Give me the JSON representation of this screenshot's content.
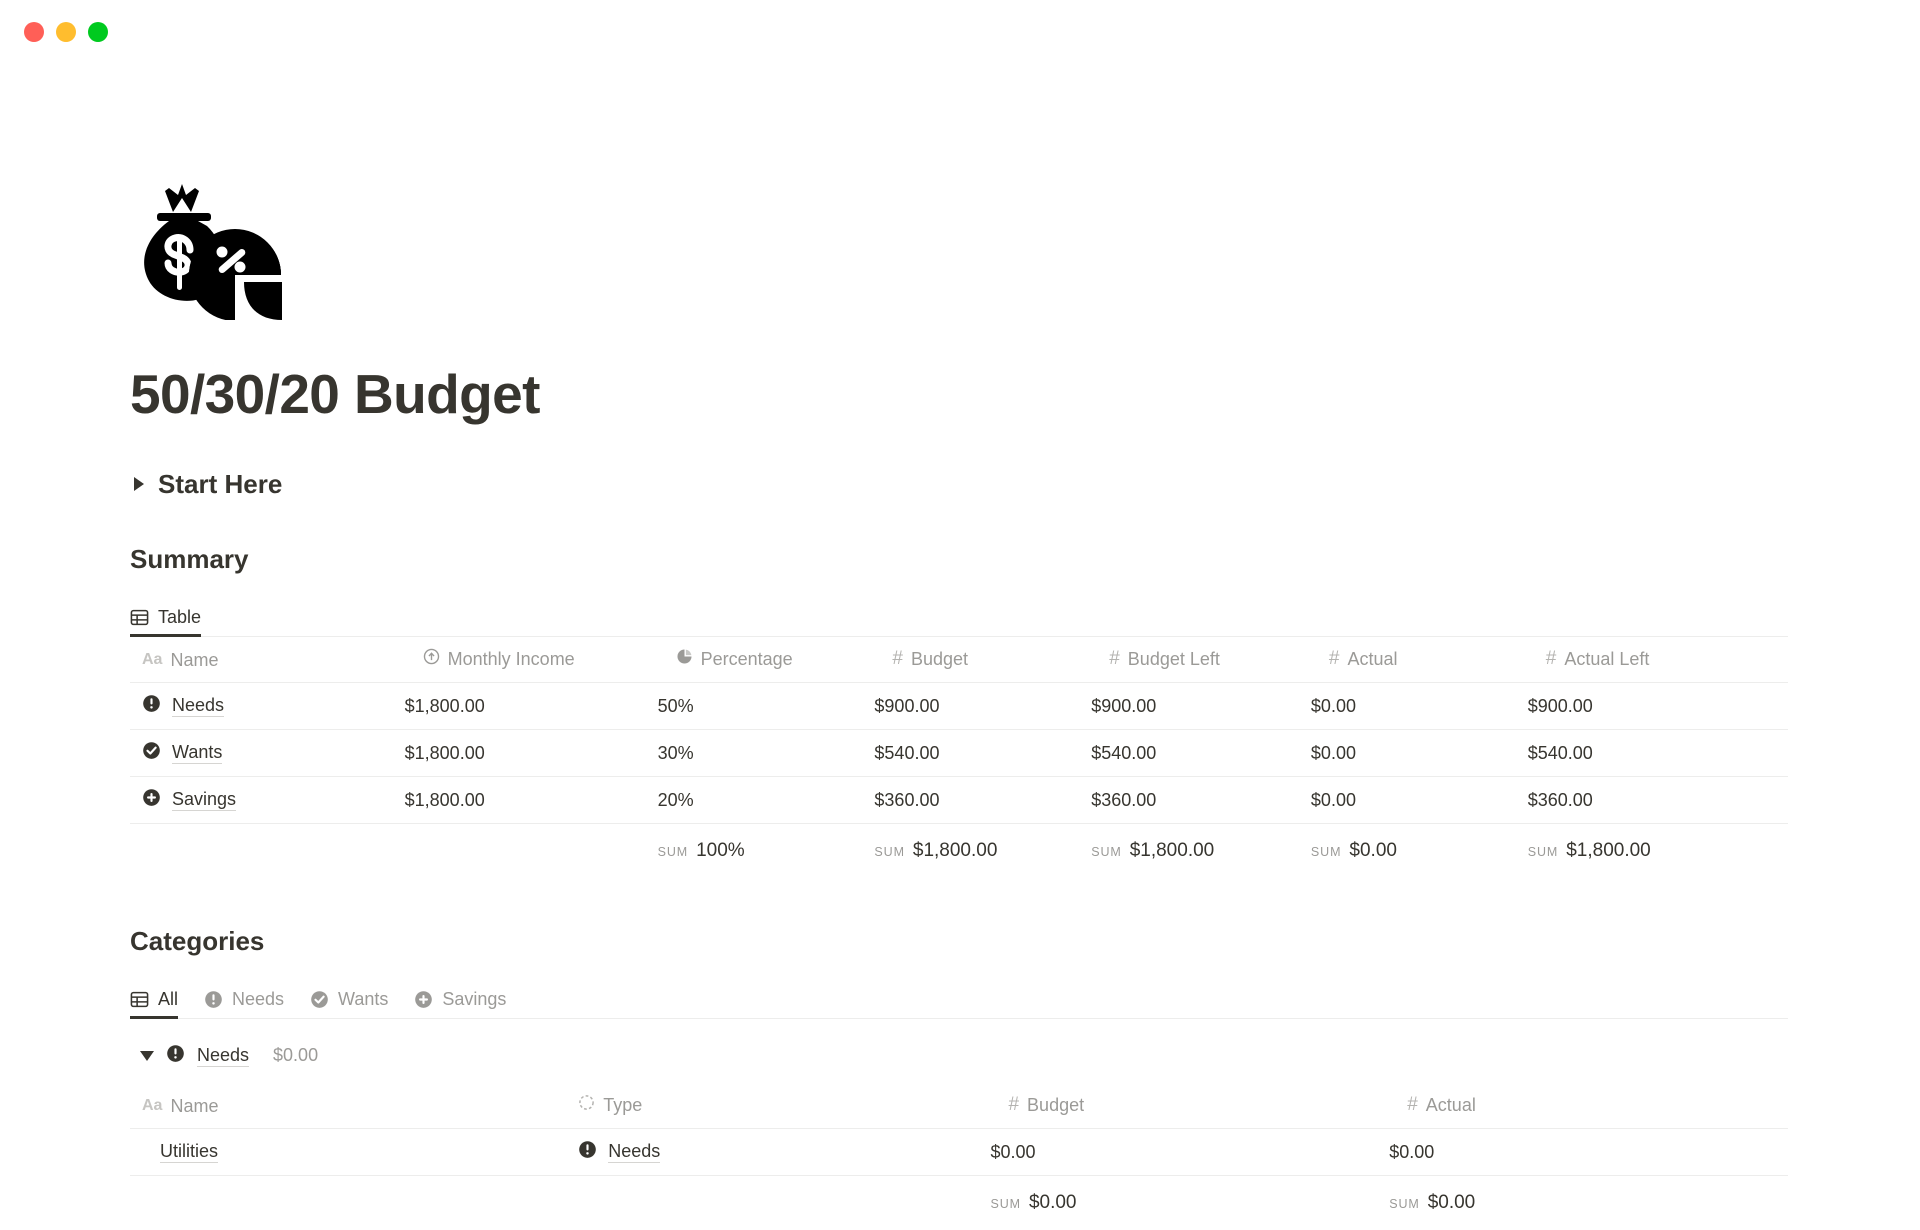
{
  "window": {
    "buttons": [
      {
        "name": "close",
        "color": "#ff5f57"
      },
      {
        "name": "minimize",
        "color": "#ffbd2e"
      },
      {
        "name": "maximize",
        "color": "#00ca1f"
      }
    ]
  },
  "page": {
    "icon": "money-bag-pie-chart-icon",
    "title": "50/30/20 Budget"
  },
  "toggle": {
    "label": "Start Here",
    "expanded": false
  },
  "summary": {
    "heading": "Summary",
    "tabs": [
      {
        "label": "Table",
        "icon": "table-icon",
        "active": true
      }
    ],
    "columns": [
      {
        "label": "Name",
        "icon": "title-icon"
      },
      {
        "label": "Monthly Income",
        "icon": "rollup-icon"
      },
      {
        "label": "Percentage",
        "icon": "formula-pie-icon"
      },
      {
        "label": "Budget",
        "icon": "number-icon"
      },
      {
        "label": "Budget Left",
        "icon": "number-icon"
      },
      {
        "label": "Actual",
        "icon": "number-icon"
      },
      {
        "label": "Actual Left",
        "icon": "number-icon"
      }
    ],
    "rows": [
      {
        "icon": "exclamation-circle-icon",
        "name": "Needs",
        "monthly_income": "$1,800.00",
        "percentage": "50%",
        "budget": "$900.00",
        "budget_left": "$900.00",
        "actual": "$0.00",
        "actual_left": "$900.00"
      },
      {
        "icon": "check-circle-icon",
        "name": "Wants",
        "monthly_income": "$1,800.00",
        "percentage": "30%",
        "budget": "$540.00",
        "budget_left": "$540.00",
        "actual": "$0.00",
        "actual_left": "$540.00"
      },
      {
        "icon": "plus-circle-icon",
        "name": "Savings",
        "monthly_income": "$1,800.00",
        "percentage": "20%",
        "budget": "$360.00",
        "budget_left": "$360.00",
        "actual": "$0.00",
        "actual_left": "$360.00"
      }
    ],
    "footer": {
      "sum_label": "SUM",
      "percentage": "100%",
      "budget": "$1,800.00",
      "budget_left": "$1,800.00",
      "actual": "$0.00",
      "actual_left": "$1,800.00"
    }
  },
  "categories": {
    "heading": "Categories",
    "tabs": [
      {
        "label": "All",
        "icon": "table-icon",
        "active": true
      },
      {
        "label": "Needs",
        "icon": "exclamation-circle-icon",
        "active": false
      },
      {
        "label": "Wants",
        "icon": "check-circle-icon",
        "active": false
      },
      {
        "label": "Savings",
        "icon": "plus-circle-icon",
        "active": false
      }
    ],
    "group": {
      "icon": "exclamation-circle-icon",
      "name": "Needs",
      "aggregate": "$0.00",
      "expanded": true
    },
    "columns": [
      {
        "label": "Name",
        "icon": "title-icon"
      },
      {
        "label": "Type",
        "icon": "select-icon"
      },
      {
        "label": "Budget",
        "icon": "number-icon"
      },
      {
        "label": "Actual",
        "icon": "number-icon"
      }
    ],
    "rows": [
      {
        "name": "Utilities",
        "type": "Needs",
        "type_icon": "exclamation-circle-icon",
        "budget": "$0.00",
        "actual": "$0.00"
      }
    ],
    "footer": {
      "sum_label": "SUM",
      "budget": "$0.00",
      "actual": "$0.00"
    }
  },
  "colors": {
    "text": "#37352f",
    "muted": "#9b9a97",
    "rule": "#ededec"
  }
}
